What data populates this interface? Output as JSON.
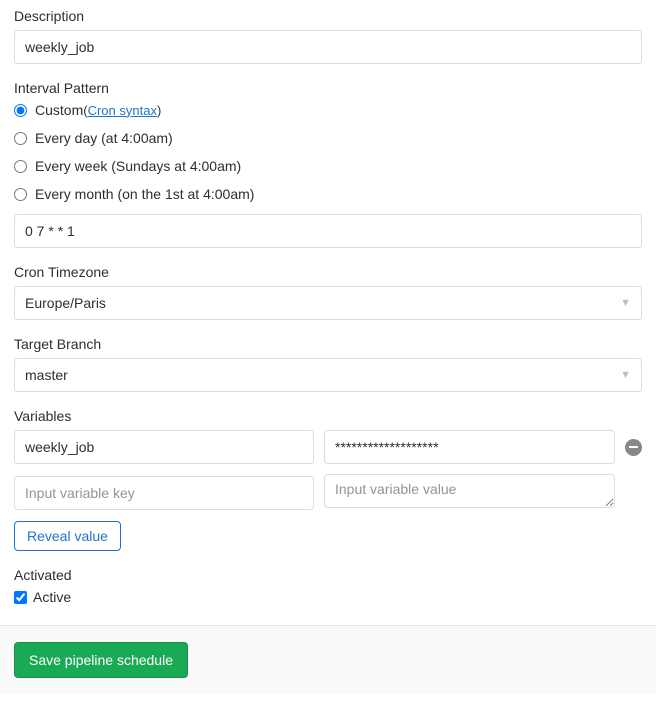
{
  "description": {
    "label": "Description",
    "value": "weekly_job"
  },
  "interval": {
    "label": "Interval Pattern",
    "options": {
      "custom": "Custom",
      "cron_paren_open": " ( ",
      "cron_link": "Cron syntax",
      "cron_paren_close": " )",
      "daily": "Every day (at 4:00am)",
      "weekly": "Every week (Sundays at 4:00am)",
      "monthly": "Every month (on the 1st at 4:00am)"
    },
    "cron_value": "0 7 * * 1"
  },
  "timezone": {
    "label": "Cron Timezone",
    "value": "Europe/Paris"
  },
  "branch": {
    "label": "Target Branch",
    "value": "master"
  },
  "variables": {
    "label": "Variables",
    "rows": [
      {
        "key": "weekly_job",
        "value": "*******************"
      }
    ],
    "placeholder_key": "Input variable key",
    "placeholder_value": "Input variable value",
    "reveal": "Reveal value"
  },
  "activated": {
    "label": "Activated",
    "checkbox": "Active"
  },
  "submit": "Save pipeline schedule"
}
